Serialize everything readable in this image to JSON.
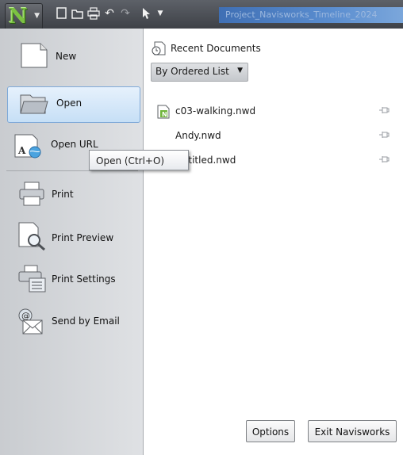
{
  "toolbar": {
    "app_logo_letter": "N",
    "window_title": "Project_Navisworks_Timeline_2024"
  },
  "menu": {
    "items": [
      {
        "label": "New",
        "icon": "new-document-icon"
      },
      {
        "label": "Open",
        "icon": "open-folder-icon"
      },
      {
        "label": "Open URL",
        "icon": "open-url-icon"
      },
      {
        "label": "Print",
        "icon": "printer-icon"
      },
      {
        "label": "Print Preview",
        "icon": "print-preview-icon"
      },
      {
        "label": "Print Settings",
        "icon": "print-settings-icon"
      },
      {
        "label": "Send by Email",
        "icon": "email-icon"
      }
    ]
  },
  "tooltip": {
    "text": "Open (Ctrl+O)"
  },
  "recent": {
    "header": "Recent Documents",
    "order_selected": "By Ordered List",
    "documents": [
      {
        "name": "c03-walking.nwd"
      },
      {
        "name": "Andy.nwd"
      },
      {
        "name": "Untitled.nwd"
      }
    ]
  },
  "footer": {
    "options_label": "Options",
    "exit_label": "Exit Navisworks"
  },
  "colors": {
    "accent": "#7cc242",
    "active_bg": "#c6dff6",
    "title_bar": "#3f6fb4"
  }
}
